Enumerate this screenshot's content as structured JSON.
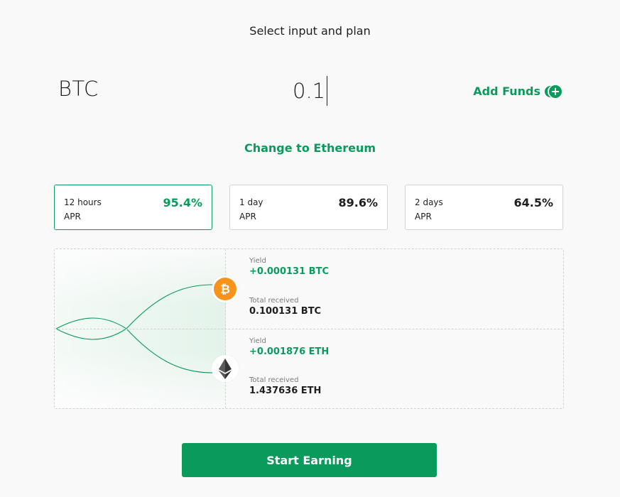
{
  "header": {
    "title": "Select input and plan"
  },
  "input": {
    "asset_symbol": "BTC",
    "amount": "0.1",
    "add_funds_label": "Add Funds",
    "add_funds_icon": "add-funds-icon"
  },
  "switch_asset": {
    "label": "Change to Ethereum"
  },
  "plans": [
    {
      "duration": "12 hours",
      "apr_label": "APR",
      "rate": "95.4%",
      "selected": true
    },
    {
      "duration": "1 day",
      "apr_label": "APR",
      "rate": "89.6%",
      "selected": false
    },
    {
      "duration": "2 days",
      "apr_label": "APR",
      "rate": "64.5%",
      "selected": false
    }
  ],
  "results": {
    "btc": {
      "icon": "bitcoin-icon",
      "yield_label": "Yield",
      "yield_value": "+0.000131 BTC",
      "total_label": "Total received",
      "total_value": "0.100131 BTC"
    },
    "eth": {
      "icon": "ethereum-icon",
      "yield_label": "Yield",
      "yield_value": "+0.001876 ETH",
      "total_label": "Total received",
      "total_value": "1.437636 ETH"
    }
  },
  "cta": {
    "label": "Start Earning"
  },
  "colors": {
    "accent": "#0a9a5c",
    "background": "#f9f9f9",
    "border": "#d4d4d4",
    "bitcoin": "#f7931a",
    "ethereum": "#343434"
  }
}
